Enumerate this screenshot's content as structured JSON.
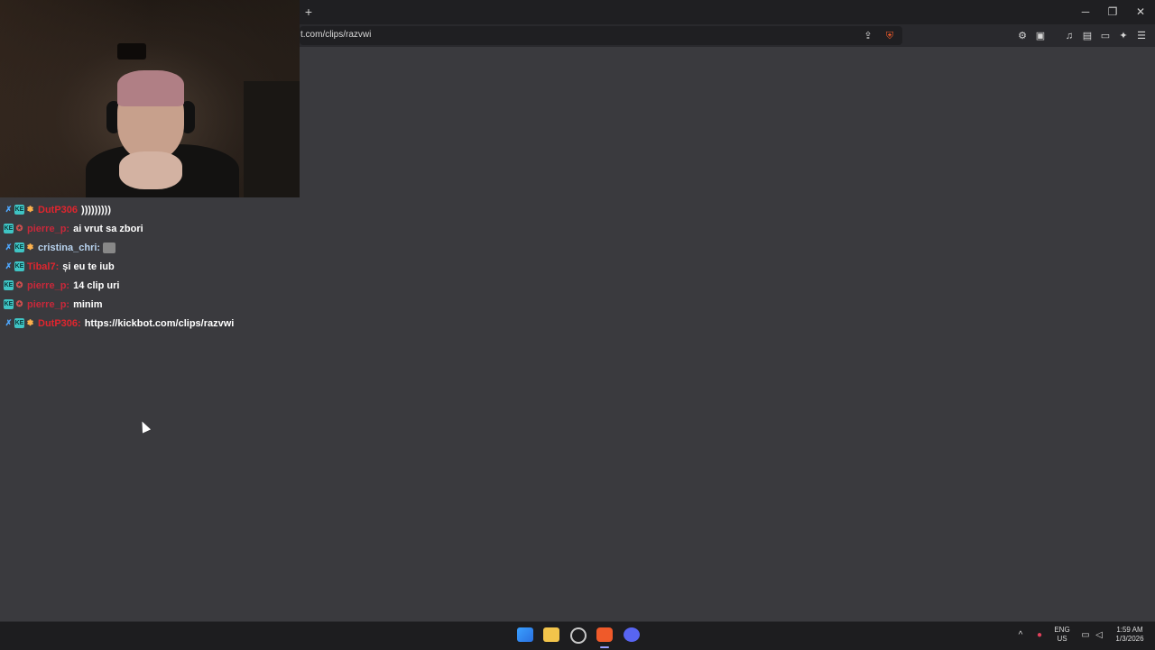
{
  "browser": {
    "url": "t.com/clips/razvwi",
    "new_tab_label": "+"
  },
  "window_controls": {
    "minimize": "─",
    "restore": "❐",
    "close": "✕"
  },
  "chat": {
    "lines": [
      {
        "badges": [
          "sword",
          "sub",
          "gift"
        ],
        "username": "DutP306",
        "user_color": "#e0252e",
        "message": ")))))))))"
      },
      {
        "badges": [
          "sub",
          "star"
        ],
        "username": "pierre_p:",
        "user_color": "#c8283a",
        "message": "ai vrut sa zbori"
      },
      {
        "badges": [
          "sword",
          "sub",
          "gift"
        ],
        "username": "cristina_chri:",
        "user_color": "#b9d4f0",
        "message": "",
        "emote": true
      },
      {
        "badges": [
          "sword",
          "sub"
        ],
        "username": "Tibal7:",
        "user_color": "#e0252e",
        "message": "și eu te iub"
      },
      {
        "badges": [
          "sub",
          "star"
        ],
        "username": "pierre_p:",
        "user_color": "#c8283a",
        "message": "14 clip uri"
      },
      {
        "badges": [
          "sub",
          "star"
        ],
        "username": "pierre_p:",
        "user_color": "#c8283a",
        "message": "minim"
      },
      {
        "badges": [
          "sword",
          "sub",
          "gift"
        ],
        "username": "DutP306:",
        "user_color": "#e0252e",
        "message": "https://kickbot.com/clips/razvwi"
      }
    ]
  },
  "taskbar": {
    "lang_line1": "ENG",
    "lang_line2": "US",
    "time": "1:59 AM",
    "date": "1/3/2026"
  }
}
